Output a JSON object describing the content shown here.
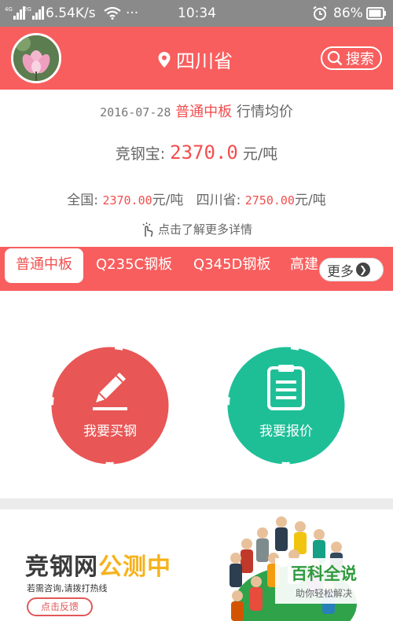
{
  "status_bar": {
    "net_tag_1": "4G",
    "net_tag_2": "2G",
    "speed": "6.54K/s",
    "dots": "···",
    "time": "10:34",
    "battery": "86%"
  },
  "header": {
    "location": "四川省",
    "search_label": "搜索"
  },
  "price_info": {
    "date": "2016-07-28",
    "product": "普通中板",
    "suffix": "行情均价",
    "jgb_label": "竞钢宝:",
    "jgb_value": "2370.0",
    "jgb_unit": "元/吨",
    "national_label": "全国:",
    "national_value": "2370.00",
    "national_unit": "元/吨",
    "province_label": "四川省:",
    "province_value": "2750.00",
    "province_unit": "元/吨",
    "detail_link": "点击了解更多详情"
  },
  "tabs": {
    "items": [
      "普通中板",
      "Q235C钢板",
      "Q345D钢板",
      "高建"
    ],
    "more_label": "更多"
  },
  "actions": {
    "buy_label": "我要买钢",
    "quote_label": "我要报价"
  },
  "banner": {
    "title_main": "竞钢网",
    "title_highlight": "公测中",
    "subtitle": "若需咨询,请拨打热线",
    "feedback_label": "点击反馈"
  },
  "watermark": {
    "title": "百科全说",
    "subtitle": "助你轻松解决"
  },
  "colors": {
    "brand_red": "#f85e5e",
    "price_red": "#f24e4e",
    "quote_green": "#1ebf97",
    "banner_yellow": "#f6b21b"
  },
  "icons": [
    "location-pin-icon",
    "search-icon",
    "hand-tap-icon",
    "chevron-right-icon",
    "pencil-icon",
    "clipboard-icon",
    "wifi-icon",
    "alarm-icon",
    "battery-icon"
  ]
}
